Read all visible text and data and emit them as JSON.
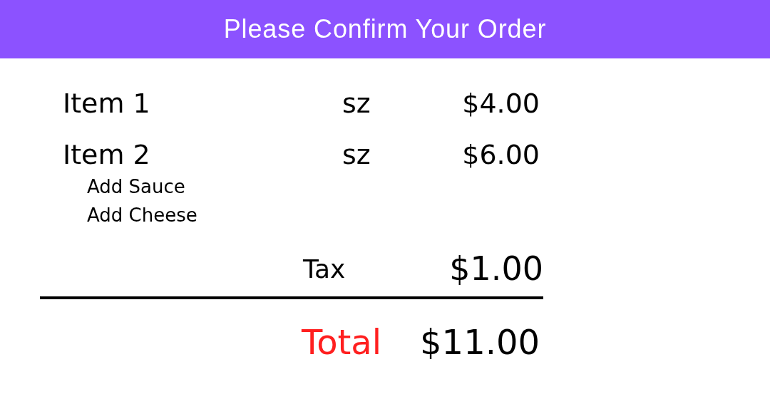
{
  "header": {
    "title": "Please Confirm Your Order"
  },
  "items": [
    {
      "name": "Item 1",
      "size": "sz",
      "price": "$4.00"
    },
    {
      "name": "Item 2",
      "size": "sz",
      "price": "$6.00",
      "modifiers": [
        "Add Sauce",
        "Add Cheese"
      ]
    }
  ],
  "tax": {
    "label": "Tax",
    "amount": "$1.00"
  },
  "total": {
    "label": "Total",
    "amount": "$11.00"
  }
}
